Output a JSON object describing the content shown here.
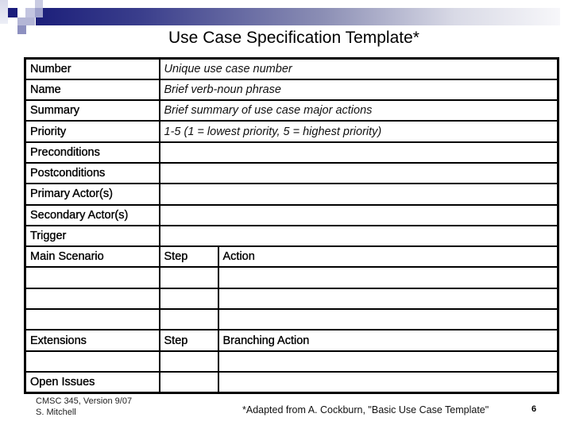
{
  "slide": {
    "title": "Use Case Specification Template*",
    "banner_colors": {
      "dark": "#1c1f7a",
      "light": "#f7f7fa"
    }
  },
  "table": {
    "field_rows": [
      {
        "label": "Number",
        "value": "Unique use case number"
      },
      {
        "label": "Name",
        "value": "Brief verb-noun phrase"
      },
      {
        "label": "Summary",
        "value": "Brief summary of use case major actions"
      },
      {
        "label": "Priority",
        "value": "1-5 (1 = lowest priority, 5 = highest priority)"
      },
      {
        "label": "Preconditions",
        "value": ""
      },
      {
        "label": "Postconditions",
        "value": ""
      },
      {
        "label": "Primary Actor(s)",
        "value": ""
      },
      {
        "label": "Secondary Actor(s)",
        "value": ""
      },
      {
        "label": "Trigger",
        "value": ""
      }
    ],
    "main_scenario": {
      "label": "Main Scenario",
      "step_header": "Step",
      "action_header": "Action",
      "empty_rows": 3
    },
    "extensions": {
      "label": "Extensions",
      "step_header": "Step",
      "action_header": "Branching Action",
      "empty_rows": 1
    },
    "open_issues": {
      "label": "Open Issues"
    }
  },
  "footer": {
    "course": "CMSC 345, Version 9/07",
    "author": "S. Mitchell",
    "attribution": "*Adapted from A. Cockburn, \"Basic Use Case Template\"",
    "page_number": "6"
  }
}
